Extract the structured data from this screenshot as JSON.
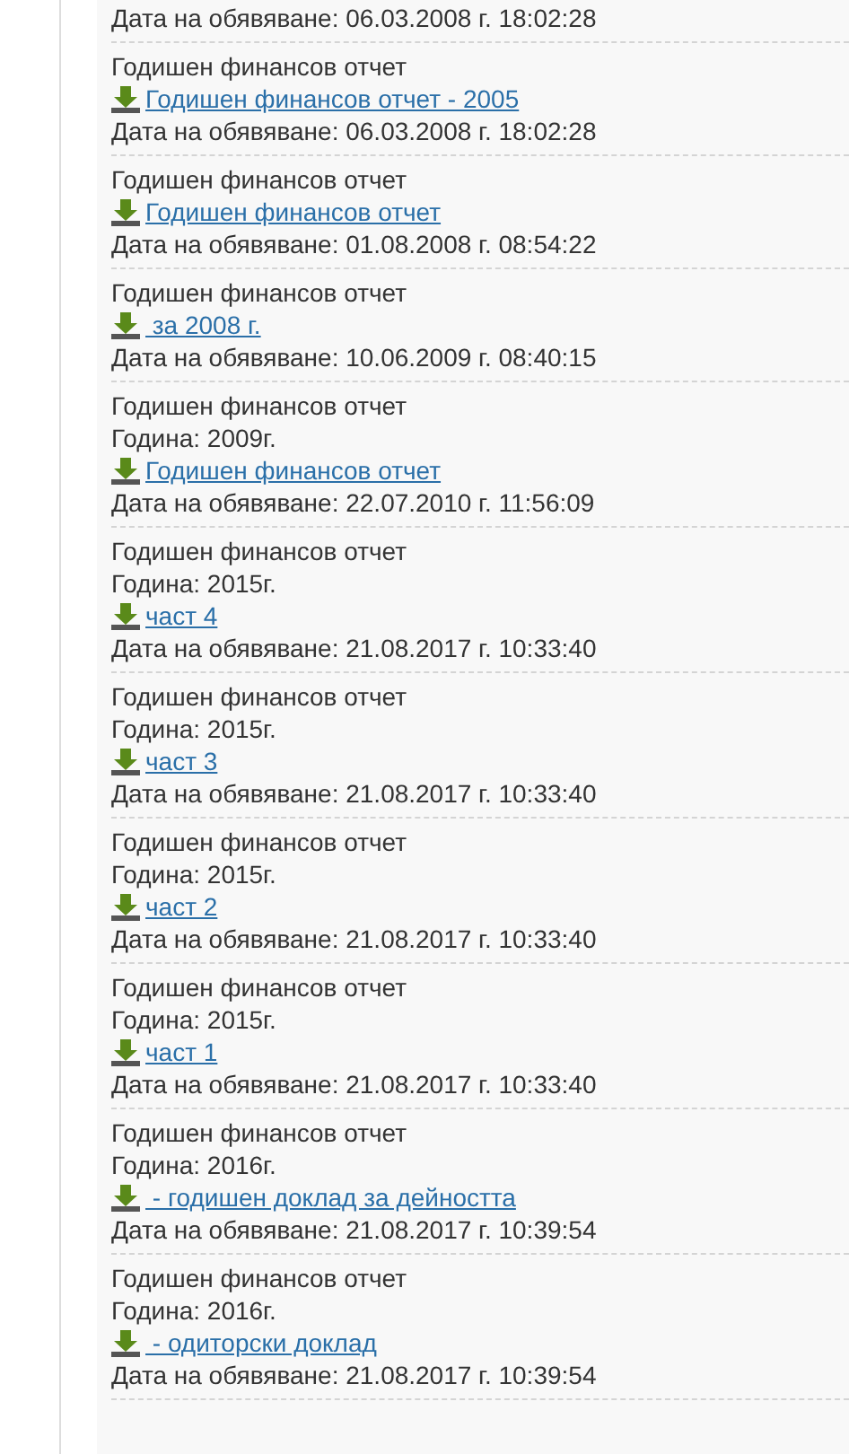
{
  "entries": [
    {
      "date": "Дата на обявяване: 06.03.2008 г. 18:02:28"
    },
    {
      "title": "Годишен финансов отчет",
      "link": "Годишен финансов отчет - 2005",
      "date": "Дата на обявяване: 06.03.2008 г. 18:02:28"
    },
    {
      "title": "Годишен финансов отчет",
      "link": "Годишен финансов отчет",
      "date": "Дата на обявяване: 01.08.2008 г. 08:54:22"
    },
    {
      "title": "Годишен финансов отчет",
      "link": " за 2008 г.",
      "date": "Дата на обявяване: 10.06.2009 г. 08:40:15"
    },
    {
      "title": "Годишен финансов отчет",
      "year": "Година: 2009г.",
      "link": "Годишен финансов отчет",
      "date": "Дата на обявяване: 22.07.2010 г. 11:56:09"
    },
    {
      "title": "Годишен финансов отчет",
      "year": "Година: 2015г.",
      "link": "част 4",
      "date": "Дата на обявяване: 21.08.2017 г. 10:33:40"
    },
    {
      "title": "Годишен финансов отчет",
      "year": "Година: 2015г.",
      "link": "част 3",
      "date": "Дата на обявяване: 21.08.2017 г. 10:33:40"
    },
    {
      "title": "Годишен финансов отчет",
      "year": "Година: 2015г.",
      "link": "част 2",
      "date": "Дата на обявяване: 21.08.2017 г. 10:33:40"
    },
    {
      "title": "Годишен финансов отчет",
      "year": "Година: 2015г.",
      "link": "част 1",
      "date": "Дата на обявяване: 21.08.2017 г. 10:33:40"
    },
    {
      "title": "Годишен финансов отчет",
      "year": "Година: 2016г.",
      "link": " - годишен доклад за дейността",
      "date": "Дата на обявяване: 21.08.2017 г. 10:39:54"
    },
    {
      "title": "Годишен финансов отчет",
      "year": "Година: 2016г.",
      "link": " - одиторски доклад",
      "date": "Дата на обявяване: 21.08.2017 г. 10:39:54"
    }
  ]
}
